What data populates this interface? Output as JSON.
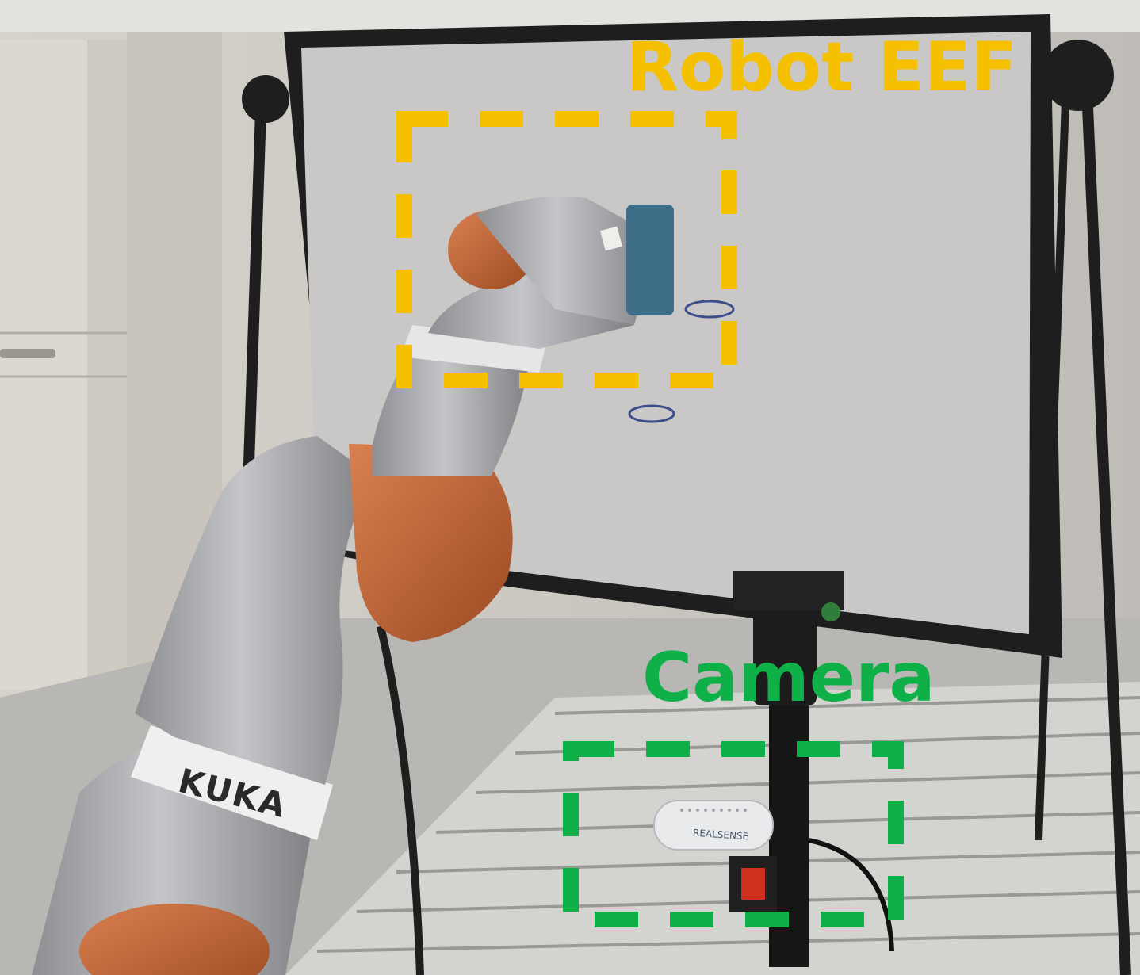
{
  "annotations": {
    "robot_eef": {
      "label": "Robot EEF",
      "color": "#F5C000"
    },
    "camera": {
      "label": "Camera",
      "color": "#10B048"
    }
  },
  "scene_text": {
    "robot_brand": "KUKA",
    "camera_brand": "REALSENSE"
  },
  "colors": {
    "board": "#C9C8C6",
    "frame": "#1E1E1E",
    "robot_body": "#A9AAAC",
    "robot_joint": "#C86A3A",
    "cabinet": "#D8D4CC",
    "floor": "#B8B6B2"
  }
}
